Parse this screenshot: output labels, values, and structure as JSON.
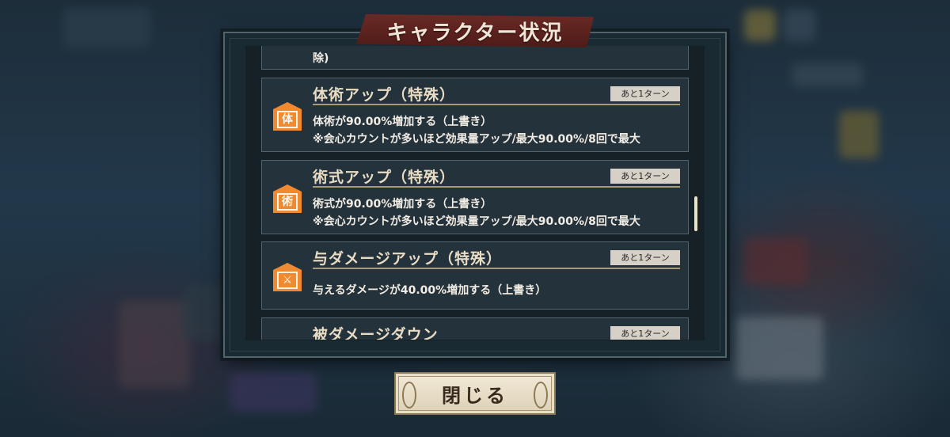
{
  "title": "キャラクター状況",
  "clipped_top_text": "除)",
  "effects": [
    {
      "name": "体術アップ（特殊）",
      "turns": "あと1ターン",
      "icon": "taijutsu-icon",
      "icon_glyph": "体",
      "lines": [
        "体術が90.00%増加する（上書き）",
        "※会心カウントが多いほど効果量アップ/最大90.00%/8回で最大"
      ]
    },
    {
      "name": "術式アップ（特殊）",
      "turns": "あと1ターン",
      "icon": "jutsushiki-icon",
      "icon_glyph": "術",
      "lines": [
        "術式が90.00%増加する（上書き）",
        "※会心カウントが多いほど効果量アップ/最大90.00%/8回で最大"
      ]
    },
    {
      "name": "与ダメージアップ（特殊）",
      "turns": "あと1ターン",
      "icon": "sword-icon",
      "icon_glyph": "⚔",
      "lines": [
        "与えるダメージが40.00%増加する（上書き）"
      ]
    },
    {
      "name": "被ダメージダウン",
      "turns": "あと1ターン"
    }
  ],
  "close_button": "閉じる"
}
